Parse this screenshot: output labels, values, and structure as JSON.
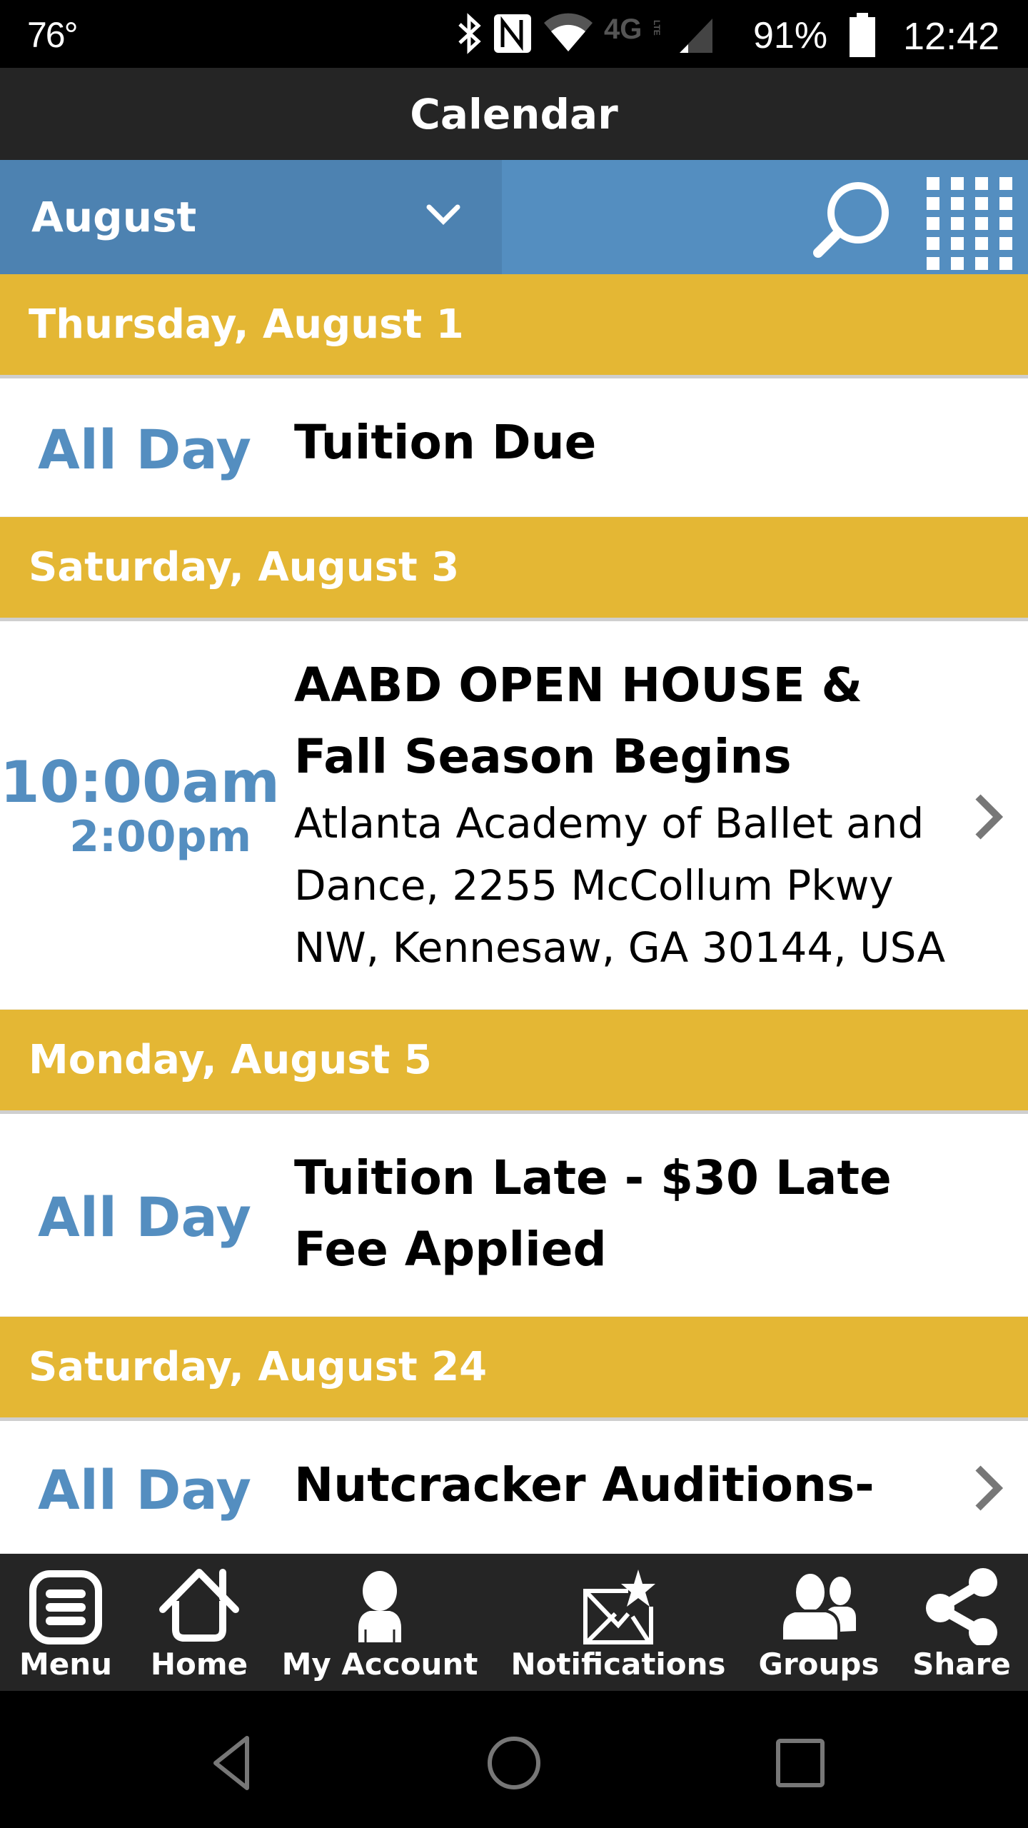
{
  "status_bar": {
    "temperature": "76°",
    "icons": [
      "bluetooth-icon",
      "nfc-icon",
      "wifi-icon",
      "4g-lte-icon",
      "signal-icon"
    ],
    "battery_percent": "91%",
    "battery_level": 0.91,
    "time": "12:42"
  },
  "header": {
    "title": "Calendar"
  },
  "month_bar": {
    "selected_month": "August",
    "search_icon": "search-icon",
    "grid_icon": "grid-view-icon"
  },
  "colors": {
    "title_bar": "#252525",
    "month_bar": "#548ec0",
    "month_select": "#4d82b1",
    "day_header": "#e4b734",
    "time_text": "#548ec0",
    "chevron": "#777777"
  },
  "days": [
    {
      "label": "Thursday, August 1",
      "events": [
        {
          "time_label": "All Day",
          "title": "Tuition Due",
          "has_chevron": false
        }
      ]
    },
    {
      "label": "Saturday, August 3",
      "events": [
        {
          "start_time": "10:00am",
          "end_time": "2:00pm",
          "title": "AABD OPEN HOUSE & Fall Season Begins",
          "location": "Atlanta Academy of Ballet and Dance, 2255 McCollum Pkwy NW, Kennesaw, GA 30144, USA",
          "has_chevron": true
        }
      ]
    },
    {
      "label": "Monday, August 5",
      "events": [
        {
          "time_label": "All Day",
          "title": "Tuition Late - $30 Late Fee Applied",
          "has_chevron": false
        }
      ]
    },
    {
      "label": "Saturday, August 24",
      "events": [
        {
          "time_label": "All Day",
          "title": "Nutcracker Auditions-",
          "has_chevron": true
        }
      ]
    }
  ],
  "bottom_nav": [
    {
      "label": "Menu",
      "icon": "menu-icon"
    },
    {
      "label": "Home",
      "icon": "home-icon"
    },
    {
      "label": "My Account",
      "icon": "account-icon"
    },
    {
      "label": "Notifications",
      "icon": "notifications-icon"
    },
    {
      "label": "Groups",
      "icon": "groups-icon"
    },
    {
      "label": "Share",
      "icon": "share-icon"
    }
  ],
  "system_nav": [
    {
      "name": "back",
      "icon": "back-icon"
    },
    {
      "name": "home",
      "icon": "system-home-icon"
    },
    {
      "name": "recents",
      "icon": "recents-icon"
    }
  ]
}
